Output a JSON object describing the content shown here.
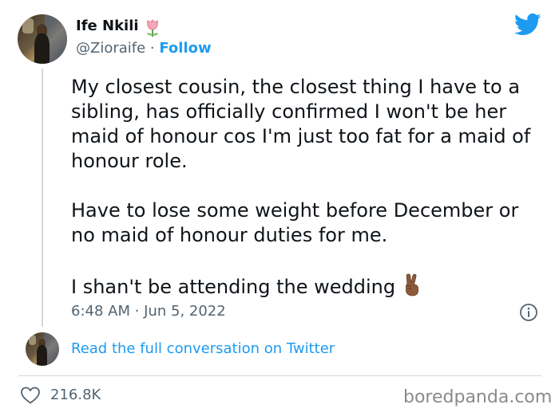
{
  "author": {
    "name": "Ife Nkili",
    "handle": "@Zioraife",
    "separator": " · ",
    "follow_label": "Follow",
    "name_emoji": "tulip-icon"
  },
  "tweet": {
    "paragraphs": [
      "My closest cousin, the closest thing I have to a sibling, has officially confirmed I won't be her maid of honour cos I'm just too fat for a maid of honour role.",
      "Have to lose some weight before December or no maid of honour duties for me.",
      "I shan't be attending the wedding"
    ],
    "trailing_emoji": "victory-hand-icon",
    "timestamp": "6:48 AM · Jun 5, 2022"
  },
  "conversation": {
    "link_label": "Read the full conversation on Twitter"
  },
  "engagement": {
    "likes": "216.8K"
  },
  "watermark": "boredpanda.com",
  "colors": {
    "link_blue": "#1d9bf0",
    "text": "#0f1419",
    "muted": "#536471",
    "divider": "#cfd9de"
  }
}
